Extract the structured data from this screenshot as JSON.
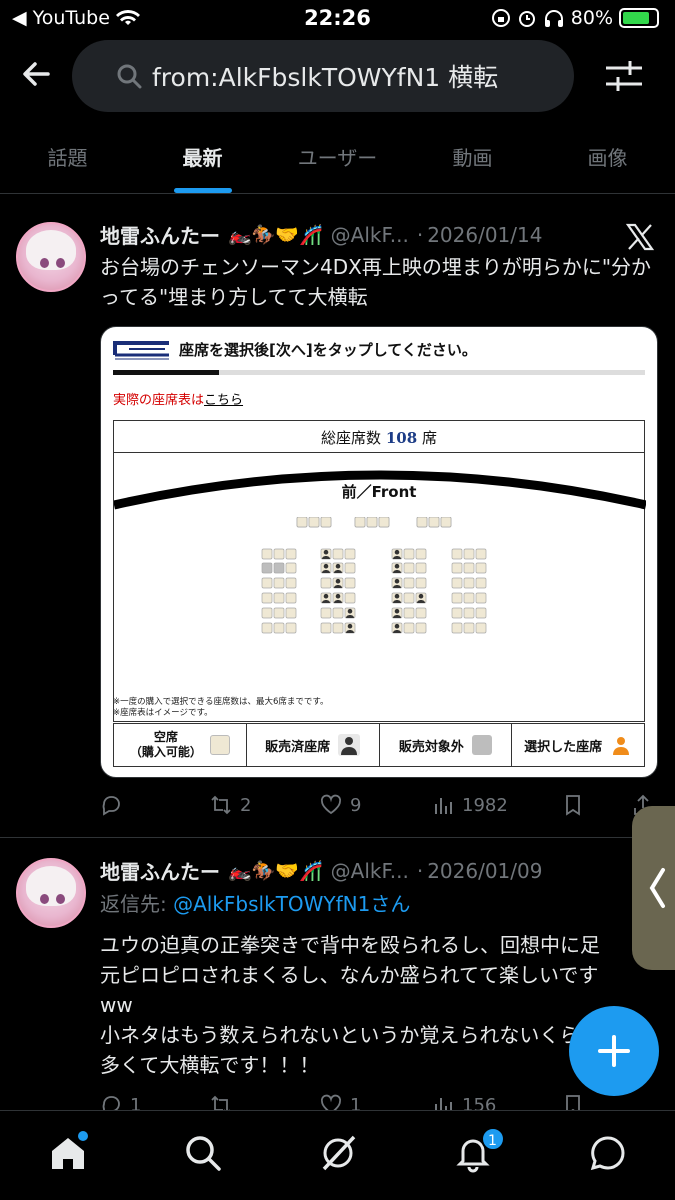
{
  "status_bar": {
    "back_app": "YouTube",
    "time": "22:26",
    "battery_percent": "80%",
    "battery_level": 0.8
  },
  "search": {
    "query": "from:AlkFbslkTOWYfN1 横転"
  },
  "tabs": [
    {
      "label": "話題",
      "active": false
    },
    {
      "label": "最新",
      "active": true
    },
    {
      "label": "ユーザー",
      "active": false
    },
    {
      "label": "動画",
      "active": false
    },
    {
      "label": "画像",
      "active": false
    }
  ],
  "tweets": [
    {
      "name": "地雷ふんたー",
      "emojis": "🏍️🏇🤝🎢",
      "handle": "@AlkF...",
      "date": "2026/01/14",
      "text": "お台場のチェンソーマン4DX再上映の埋まりが明らかに\"分かってる\"埋まり方してて大横転",
      "replies": "",
      "retweets": "2",
      "likes": "9",
      "views": "1982",
      "media": {
        "instruction": "座席を選択後[次へ]をタップしてください。",
        "progress": 0.2,
        "note_red": "実際の座席表は",
        "note_link": "こちら",
        "total_label": "総座席数",
        "total_value": "108",
        "total_unit": "席",
        "front_label": "前／Front",
        "footnote1": "※一度の購入で選択できる座席数は、最大6席までです。",
        "footnote2": "※座席表はイメージです。",
        "legend": {
          "available_line1": "空席",
          "available_line2": "（購入可能）",
          "sold": "販売済座席",
          "not_for_sale": "販売対象外",
          "selected": "選択した座席"
        }
      }
    },
    {
      "name": "地雷ふんたー",
      "emojis": "🏍️🏇🤝🎢",
      "handle": "@AlkF...",
      "date": "2026/01/09",
      "reply_prefix": "返信先:",
      "reply_handle": "@AlkFbslkTOWYfN1さん",
      "text_lines": [
        "ユウの迫真の正拳突きで背中を殴られるし、回想中に足",
        "元ピロピロされまくるし、なんか盛られてて楽しいです",
        "ww",
        "小ネタはもう数えられないというか覚えられないくらい",
        "多くて大横転です！！！"
      ],
      "replies": "1",
      "likes": "1",
      "views": "156"
    }
  ],
  "bottom_nav": {
    "notifications_badge": "1"
  },
  "colors": {
    "accent": "#1d9bf0",
    "background": "#000000",
    "muted": "#71767b"
  }
}
